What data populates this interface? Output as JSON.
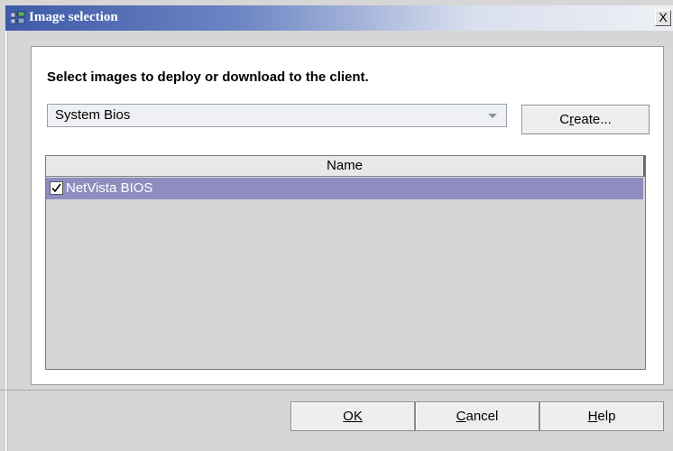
{
  "window": {
    "title": "Image selection",
    "close_glyph": "X"
  },
  "prompt": "Select images to deploy or download to the client.",
  "image_type_select": {
    "value": "System Bios"
  },
  "create_button": {
    "label": "Create..."
  },
  "table": {
    "columns": [
      "Name"
    ],
    "rows": [
      {
        "checked": true,
        "name": "NetVista BIOS",
        "selected": true
      }
    ]
  },
  "footer": {
    "ok_label": "OK",
    "cancel_label": "Cancel",
    "help_label": "Help"
  },
  "colors": {
    "selection": "#8f8dc0",
    "title_gradient_start": "#3e5aa8"
  },
  "icons": {
    "title": "computer-network-icon",
    "close": "close-icon",
    "dropdown": "chevron-down-icon",
    "check": "checkmark-icon"
  }
}
